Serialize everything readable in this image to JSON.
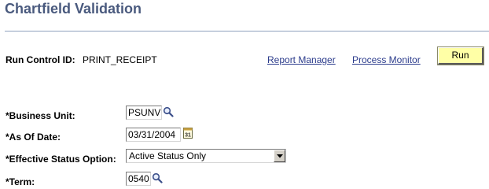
{
  "page": {
    "title": "Chartfield Validation"
  },
  "run_control": {
    "label": "Run Control ID:",
    "value": "PRINT_RECEIPT"
  },
  "links": {
    "report_manager": "Report Manager",
    "process_monitor": "Process Monitor"
  },
  "toolbar": {
    "run_label": "Run"
  },
  "form": {
    "business_unit": {
      "label": "*Business Unit:",
      "value": "PSUNV",
      "icon": "lookup-icon"
    },
    "as_of_date": {
      "label": "*As Of Date:",
      "value": "03/31/2004",
      "icon": "calendar-icon",
      "icon_text": "31"
    },
    "effective_status": {
      "label": "*Effective Status Option:",
      "selected": "Active Status Only"
    },
    "term": {
      "label": "*Term:",
      "value": "0540",
      "icon": "lookup-icon"
    }
  },
  "colors": {
    "title": "#4a5a7e",
    "rule": "#8fa0bd",
    "link": "#2c3c8c",
    "run_button": "#ffffa6"
  }
}
